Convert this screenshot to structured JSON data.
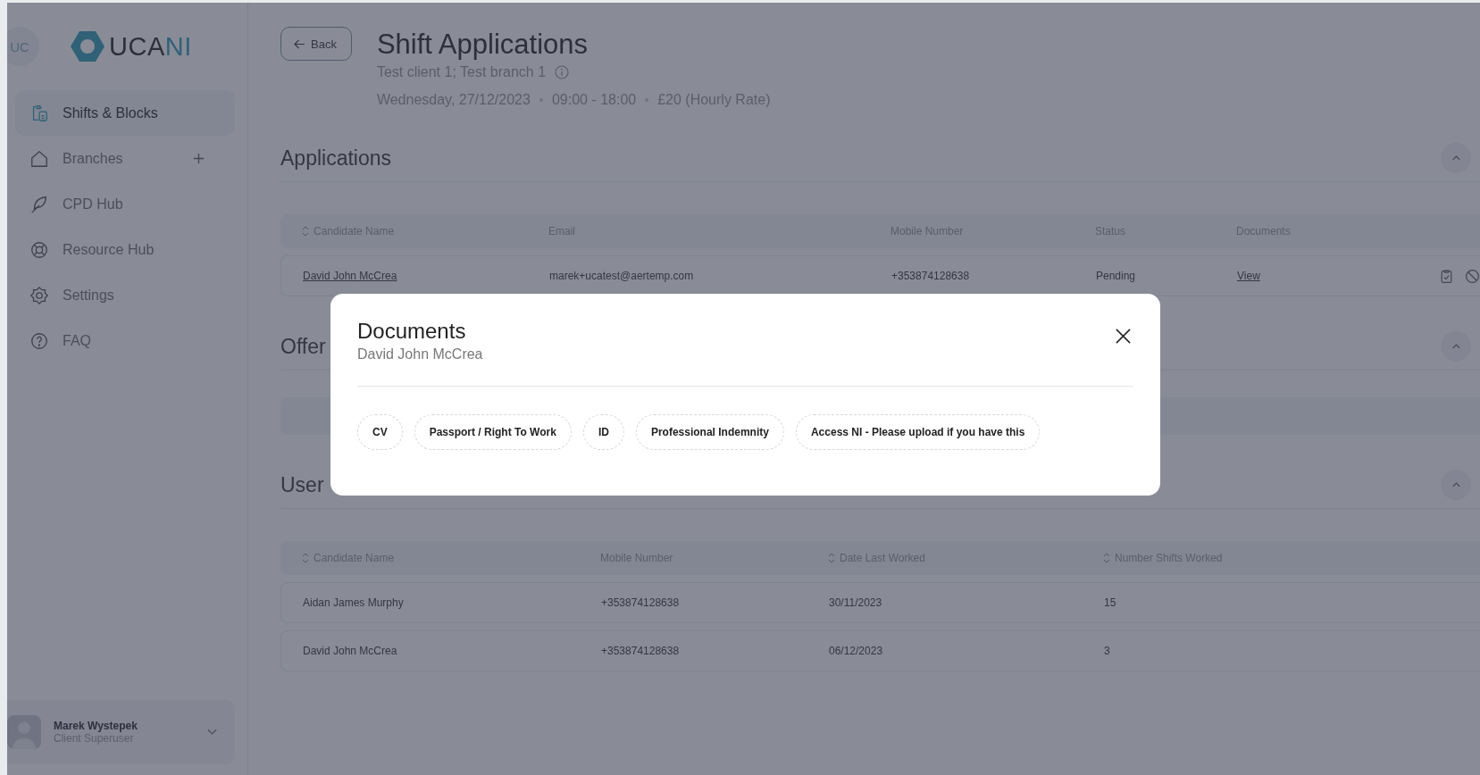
{
  "sidebar": {
    "avatar": "UC",
    "logo": {
      "parts": [
        "UCA",
        "NI"
      ]
    },
    "items": [
      {
        "label": "Shifts & Blocks",
        "selected": true,
        "addable": false
      },
      {
        "label": "Branches",
        "selected": false,
        "addable": true
      },
      {
        "label": "CPD Hub",
        "selected": false,
        "addable": false
      },
      {
        "label": "Resource Hub",
        "selected": false,
        "addable": false
      },
      {
        "label": "Settings",
        "selected": false,
        "addable": false
      },
      {
        "label": "FAQ",
        "selected": false,
        "addable": false
      }
    ],
    "user": {
      "name": "Marek Wystepek",
      "role": "Client Superuser"
    }
  },
  "header": {
    "back": "Back",
    "title": "Shift Applications",
    "subtitle": "Test client 1; Test branch 1",
    "meta": [
      "Wednesday, 27/12/2023",
      "09:00 - 18:00",
      "£20 (Hourly Rate)"
    ]
  },
  "applications": {
    "title": "Applications",
    "expanded": true,
    "columns": [
      {
        "label": "Candidate Name",
        "sortable": true
      },
      {
        "label": "Email",
        "sortable": false
      },
      {
        "label": "Mobile Number",
        "sortable": false
      },
      {
        "label": "Status",
        "sortable": false
      },
      {
        "label": "Documents",
        "sortable": false
      }
    ],
    "rows": [
      {
        "name": "David John McCrea",
        "email": "marek+ucatest@aertemp.com",
        "mobile": "+353874128638",
        "status": "Pending",
        "documents": "View"
      }
    ]
  },
  "offers": {
    "title": "Offer",
    "expanded": true
  },
  "users": {
    "title": "User",
    "expanded": true,
    "columns": [
      {
        "label": "Candidate Name",
        "sortable": true
      },
      {
        "label": "Mobile Number",
        "sortable": false
      },
      {
        "label": "Date Last Worked",
        "sortable": true
      },
      {
        "label": "Number Shifts Worked",
        "sortable": true
      }
    ],
    "rows": [
      {
        "cells": [
          "Aidan James Murphy",
          "+353874128638",
          "30/11/2023",
          "15"
        ]
      },
      {
        "cells": [
          "David John McCrea",
          "+353874128638",
          "06/12/2023",
          "3"
        ]
      }
    ]
  },
  "modal": {
    "title": "Documents",
    "subtitle": "David John McCrea",
    "documents": [
      "CV",
      "Passport / Right To Work",
      "ID",
      "Professional Indemnity",
      "Access NI - Please upload if you have this"
    ]
  }
}
